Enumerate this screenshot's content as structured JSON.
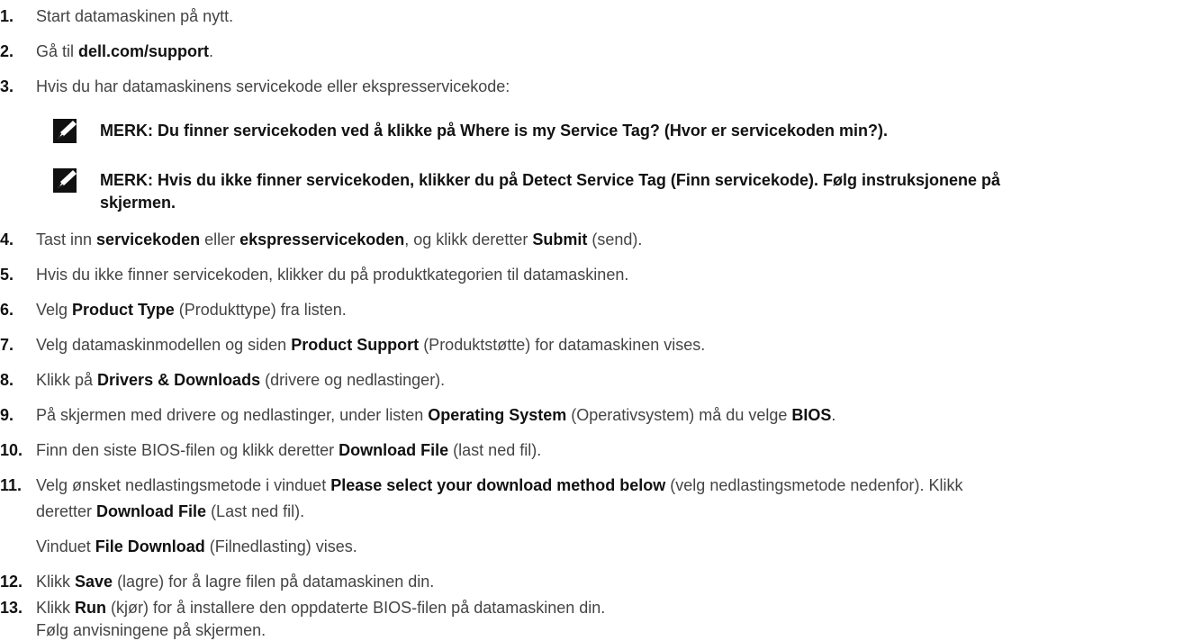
{
  "steps": [
    {
      "num": "1.",
      "parts": [
        "Start datamaskinen på nytt."
      ]
    },
    {
      "num": "2.",
      "parts": [
        "Gå til ",
        "dell.com/support",
        "."
      ]
    },
    {
      "num": "3.",
      "parts": [
        "Hvis du har datamaskinens servicekode eller ekspresservicekode:"
      ]
    },
    {
      "num": "4.",
      "parts": [
        "Tast inn ",
        "servicekoden",
        " eller ",
        "ekspresservicekoden",
        ", og klikk deretter ",
        "Submit",
        " (send)."
      ]
    },
    {
      "num": "5.",
      "parts": [
        "Hvis du ikke finner servicekoden, klikker du på produktkategorien til datamaskinen."
      ]
    },
    {
      "num": "6.",
      "parts": [
        "Velg ",
        "Product Type",
        " (Produkttype) fra listen."
      ]
    },
    {
      "num": "7.",
      "parts": [
        "Velg datamaskinmodellen og siden ",
        "Product Support",
        " (Produktstøtte) for datamaskinen vises."
      ]
    },
    {
      "num": "8.",
      "parts": [
        "Klikk på ",
        "Drivers & Downloads",
        " (drivere og nedlastinger)."
      ]
    },
    {
      "num": "9.",
      "parts": [
        "På skjermen med drivere og nedlastinger, under listen ",
        "Operating System",
        " (Operativsystem) må du velge ",
        "BIOS",
        "."
      ]
    },
    {
      "num": "10.",
      "parts": [
        "Finn den siste BIOS-filen og klikk deretter ",
        "Download File",
        " (last ned fil)."
      ]
    },
    {
      "num": "11.",
      "parts": [
        "Velg ønsket nedlastingsmetode i vinduet ",
        "Please select your download method below",
        " (velg nedlastingsmetode nedenfor). Klikk"
      ]
    },
    {
      "num": "12.",
      "parts": [
        "Klikk ",
        "Save",
        " (lagre) for å lagre filen på datamaskinen din."
      ]
    },
    {
      "num": "13.",
      "parts": [
        "Klikk ",
        "Run",
        " (kjør) for å installere den oppdaterte BIOS-filen på datamaskinen din."
      ]
    }
  ],
  "notes": [
    {
      "lines": [
        "MERK: Du finner servicekoden ved å klikke på Where is my Service Tag? (Hvor er servicekoden min?)."
      ]
    },
    {
      "lines": [
        "MERK: Hvis du ikke finner servicekoden, klikker du på Detect Service Tag (Finn servicekode). Følg instruksjonene på",
        "skjermen."
      ]
    }
  ],
  "step11_cont": [
    "deretter ",
    "Download File",
    " (Last ned fil)."
  ],
  "step11_sub": [
    "Vinduet ",
    "File Download",
    " (Filnedlasting) vises."
  ],
  "step13_sub": [
    "Følg anvisningene på skjermen."
  ]
}
